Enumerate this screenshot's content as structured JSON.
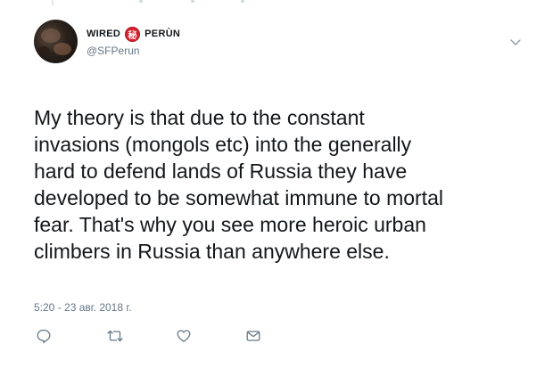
{
  "tweet": {
    "display_name_left": "WIRED",
    "seal_glyph": "秘",
    "display_name_right": "PERÙN",
    "handle": "@SFPerun",
    "text": "My theory is that due to the constant\ninvasions (mongols etc) into the generally\nhard to defend lands of Russia they have\ndeveloped to be somewhat immune to mortal\nfear. That's why you see more heroic urban\nclimbers in Russia than anywhere else.",
    "timestamp": "5:20 - 23 авг. 2018 г."
  },
  "icons": {
    "caret": "chevron-down-icon",
    "reply": "reply-icon",
    "retweet": "retweet-icon",
    "like": "heart-icon",
    "message": "envelope-icon"
  },
  "colors": {
    "text": "#14171a",
    "secondary": "#657786",
    "seal": "#d4242e"
  }
}
